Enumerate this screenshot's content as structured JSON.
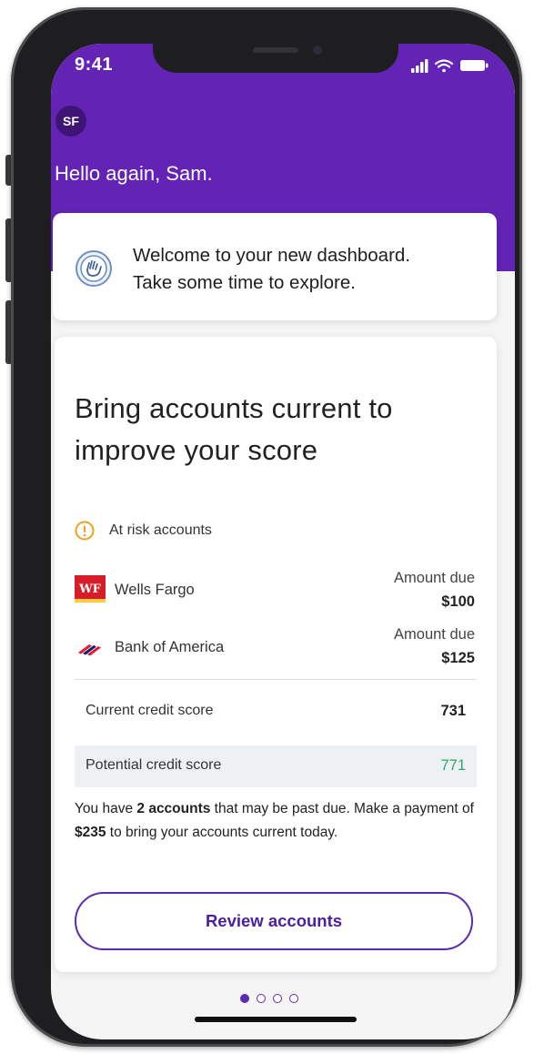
{
  "status_bar": {
    "time": "9:41"
  },
  "header": {
    "avatar_initials": "SF",
    "greeting": "Hello again, Sam."
  },
  "welcome_card": {
    "line1": "Welcome to your new dashboard.",
    "line2": "Take some time to explore."
  },
  "main_card": {
    "title_line1": "Bring accounts current to",
    "title_line2": "improve your score",
    "risk_label": "At risk accounts",
    "accounts": [
      {
        "logo_text": "WF",
        "name": "Wells Fargo",
        "due_label": "Amount due",
        "due_amount": "$100"
      },
      {
        "name": "Bank of America",
        "due_label": "Amount due",
        "due_amount": "$125"
      }
    ],
    "scores": {
      "current_label": "Current credit score",
      "current_value": "731",
      "potential_label": "Potential credit score",
      "potential_value": "771"
    },
    "explain": {
      "part1": "You have ",
      "accounts_count": "2 accounts",
      "part2": " that may be past due. Make a payment of ",
      "amount": "$235",
      "part3": " to bring your accounts current today."
    },
    "review_button": "Review accounts"
  },
  "pagination": {
    "pages": 4,
    "active_index": 0
  },
  "colors": {
    "brand_purple": "#6323b5",
    "accent_purple": "#5b2bb0",
    "warning_orange": "#f0a020",
    "positive_green": "#2ea56a",
    "wells_fargo_red": "#d71e28",
    "wells_fargo_yellow": "#ffcd41"
  }
}
